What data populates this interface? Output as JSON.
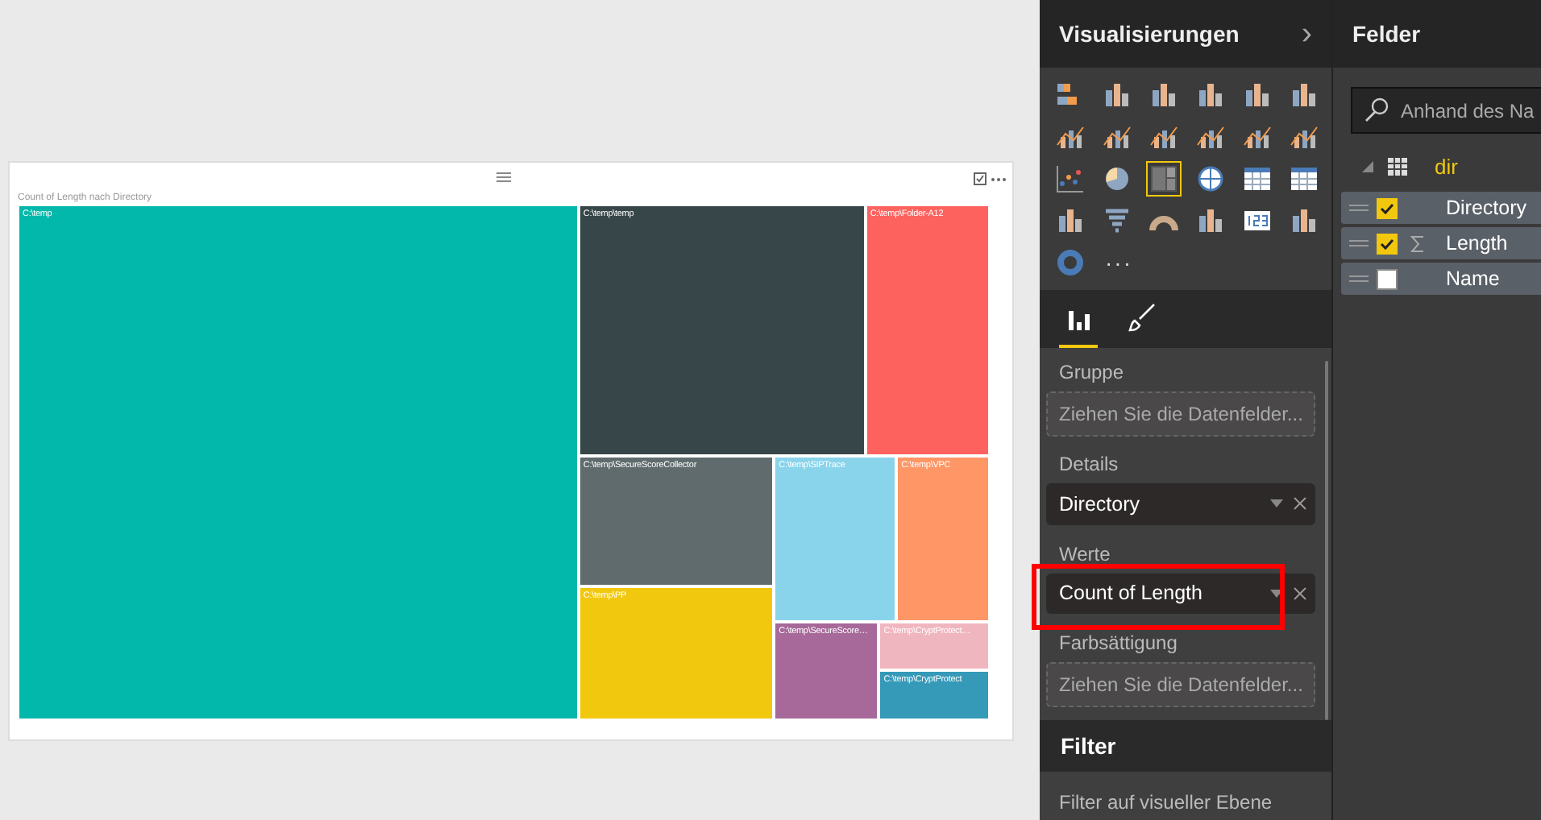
{
  "visual": {
    "title": "Count of Length nach Directory",
    "treemap_tiles": [
      {
        "label": "C:\\temp",
        "color": "#01b8aa"
      },
      {
        "label": "C:\\temp\\temp",
        "color": "#374649"
      },
      {
        "label": "C:\\temp\\Folder-A12",
        "color": "#fd625e"
      },
      {
        "label": "C:\\temp\\SecureScoreCollector",
        "color": "#5f6b6d"
      },
      {
        "label": "C:\\temp\\PP",
        "color": "#f2c80f"
      },
      {
        "label": "C:\\temp\\SIPTrace",
        "color": "#8ad4eb"
      },
      {
        "label": "C:\\temp\\VPC",
        "color": "#fe9666"
      },
      {
        "label": "C:\\temp\\SecureScore…",
        "color": "#a66999"
      },
      {
        "label": "C:\\temp\\CryptProtect…",
        "color": "#f0b6c0"
      },
      {
        "label": "C:\\temp\\CryptProtect",
        "color": "#3599b8"
      }
    ]
  },
  "visualizations": {
    "title": "Visualisierungen",
    "collapse_icon": "›",
    "visual_types": [
      {
        "selected": false
      },
      {
        "selected": false
      },
      {
        "selected": false
      },
      {
        "selected": false
      },
      {
        "selected": false
      },
      {
        "selected": false
      },
      {
        "selected": false
      },
      {
        "selected": false
      },
      {
        "selected": false
      },
      {
        "selected": false
      },
      {
        "selected": false
      },
      {
        "selected": false
      },
      {
        "selected": false
      },
      {
        "selected": false
      },
      {
        "selected": true
      },
      {
        "selected": false
      },
      {
        "selected": false
      },
      {
        "selected": false
      },
      {
        "selected": false
      },
      {
        "selected": false
      },
      {
        "selected": false
      },
      {
        "selected": false
      },
      {
        "selected": false
      },
      {
        "selected": false
      },
      {
        "selected": false
      }
    ],
    "more": "···",
    "pane_tabs": [
      {
        "selected": true
      },
      {
        "selected": false
      }
    ],
    "wells": [
      {
        "label": "Gruppe",
        "placeholder": "Ziehen Sie die Datenfelder..."
      },
      {
        "label": "Details",
        "value": "Directory"
      },
      {
        "label": "Werte",
        "value": "Count of Length",
        "highlighted": true
      },
      {
        "label": "Farbsättigung",
        "placeholder": "Ziehen Sie die Datenfelder..."
      }
    ],
    "filter_title": "Filter",
    "filter_section": "Filter auf visueller Ebene"
  },
  "fields": {
    "title": "Felder",
    "search": {
      "placeholder": "Anhand des Na"
    },
    "tables": [
      {
        "name": "dir",
        "expanded": true,
        "children": [
          {
            "name": "Directory",
            "kind": "text",
            "checked": true
          },
          {
            "name": "Length",
            "kind": "numeric",
            "checked": true
          },
          {
            "name": "Name",
            "kind": "text",
            "checked": false
          }
        ]
      }
    ]
  }
}
